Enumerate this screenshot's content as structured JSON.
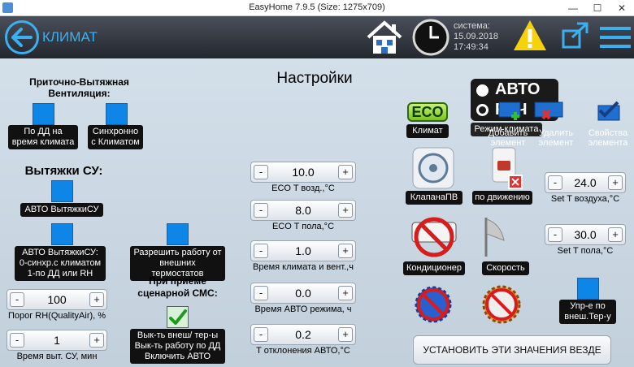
{
  "window": {
    "title": "EasyHome 7.9.5 (Size: 1275x709)",
    "minimize": "—",
    "maximize": "☐",
    "close": "✕"
  },
  "header": {
    "title": "КЛИМАТ",
    "system_label": "система:",
    "date": "15.09.2018",
    "time": "17:49:34"
  },
  "page": {
    "title": "Настройки"
  },
  "ventilation": {
    "heading1": "Приточно-Вытяжная",
    "heading2": "Вентиляция:",
    "option1_line1": "По ДД на",
    "option1_line2": "время климата",
    "option2_line1": "Синхронно",
    "option2_line2": "с Климатом"
  },
  "exhaust": {
    "heading": "Вытяжки СУ:",
    "auto_label": "АВТО ВытяжкиСУ",
    "mode_line1": "АВТО ВытяжкиСУ:",
    "mode_line2": "0-синхр.с климатом",
    "mode_line3": "1-по ДД или RH",
    "allow_line1": "Разрешить работу от",
    "allow_line2": "внешних термостатов",
    "sms_line1": "При приёме",
    "sms_line2": "сценарной СМС:",
    "sms_opt_line1": "Вык-ть внеш/ тер-ы",
    "sms_opt_line2": "Вык-ть работу по ДД",
    "sms_opt_line3": "Включить АВТО"
  },
  "steppers": {
    "rh_threshold": {
      "value": "100",
      "label": "Порог RH(QualityAir), %"
    },
    "exhaust_time": {
      "value": "1",
      "label": "Время выт. СУ, мин"
    },
    "eco_air": {
      "value": "10.0",
      "label": "ECO T возд.,°C"
    },
    "eco_floor": {
      "value": "8.0",
      "label": "ECO T пола,°C"
    },
    "climate_time": {
      "value": "1.0",
      "label": "Время климата и вент.,ч"
    },
    "auto_time": {
      "value": "0.0",
      "label": "Время АВТО режима, ч"
    },
    "auto_deviation": {
      "value": "0.2",
      "label": "T отклонения АВТО,°C"
    },
    "set_air": {
      "value": "24.0",
      "label": "Set T воздуха,°C"
    },
    "set_floor": {
      "value": "30.0",
      "label": "Set T пола,°C"
    },
    "minus": "-",
    "plus": "+"
  },
  "devices": {
    "eco_badge": "ECO",
    "climate": "Климат",
    "auto_word": "АВТО",
    "manual_word": "РУЧ",
    "mode_overlay": "Режим климата",
    "add_element_line1": "Добавить",
    "add_element_line2": "элемент",
    "delete_element_line1": "Удалить",
    "delete_element_line2": "элемент",
    "element_props_line1": "Свойства",
    "element_props_line2": "элемента",
    "valve": "КлапанаПВ",
    "motion": "по движению",
    "conditioner": "Кондиционер",
    "speed": "Скорость",
    "ext_thermostat_line1": "Упр-е по",
    "ext_thermostat_line2": "внеш.Тер-у"
  },
  "actions": {
    "set_all": "УСТАНОВИТЬ ЭТИ ЗНАЧЕНИЯ ВЕЗДЕ"
  },
  "colors": {
    "accent": "#3ab0f0",
    "checkbox": "#0d86e8",
    "topbar": "#2f333b",
    "panel": "#c9d6e2"
  }
}
